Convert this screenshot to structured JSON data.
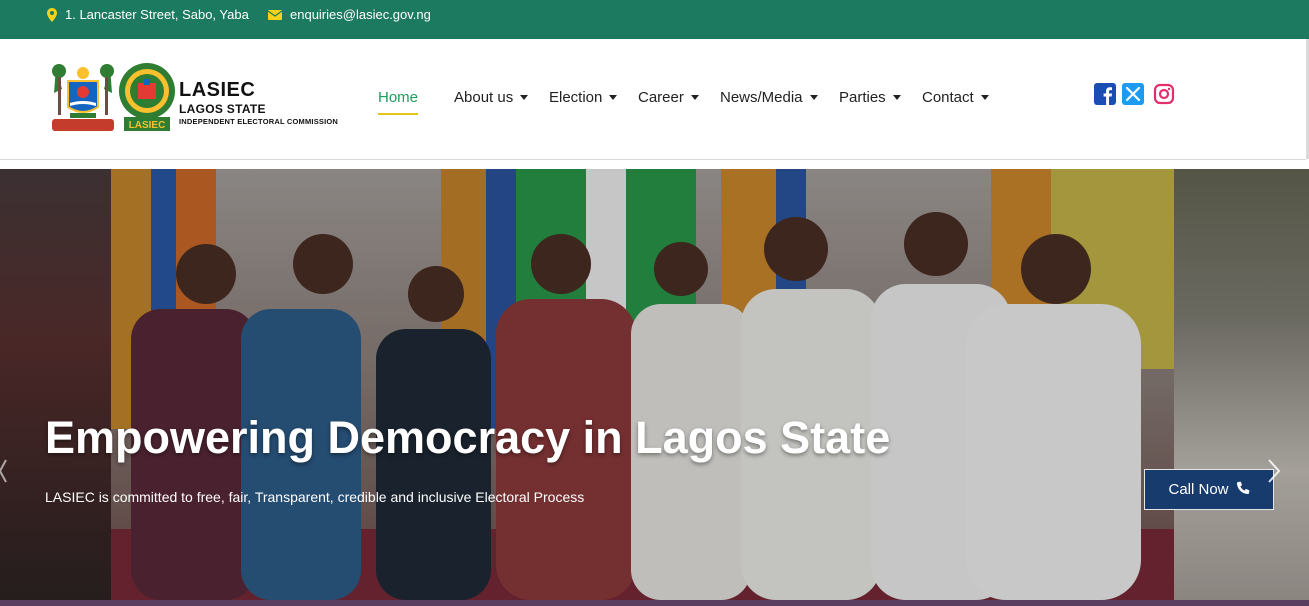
{
  "topbar": {
    "address": "1. Lancaster Street, Sabo, Yaba",
    "email": "enquiries@lasiec.gov.ng"
  },
  "brand": {
    "name": "LASIEC",
    "line2": "LAGOS STATE",
    "line3": "INDEPENDENT ELECTORAL COMMISSION",
    "badge_text": "LASIEC"
  },
  "nav": {
    "items": [
      {
        "label": "Home",
        "active": true,
        "dropdown": false
      },
      {
        "label": "About us",
        "dropdown": true
      },
      {
        "label": "Election",
        "dropdown": true
      },
      {
        "label": "Career",
        "dropdown": true
      },
      {
        "label": "News/Media",
        "dropdown": true
      },
      {
        "label": "Parties",
        "dropdown": true
      },
      {
        "label": "Contact",
        "dropdown": true
      }
    ]
  },
  "social": {
    "icons": [
      "facebook-icon",
      "x-icon",
      "instagram-icon"
    ]
  },
  "hero": {
    "title": "Empowering Democracy in Lagos State",
    "subtitle": "LASIEC is committed to free, fair, Transparent, credible and inclusive Electoral Process",
    "cta_label": "Call Now"
  },
  "colors": {
    "topbar": "#1b7a5f",
    "active_nav": "#1f9d5c",
    "active_underline": "#e3c51b",
    "cta_bg": "#163b6c",
    "facebook": "#1877f2",
    "x": "#1d9bf0",
    "instagram": "#e1306c"
  }
}
